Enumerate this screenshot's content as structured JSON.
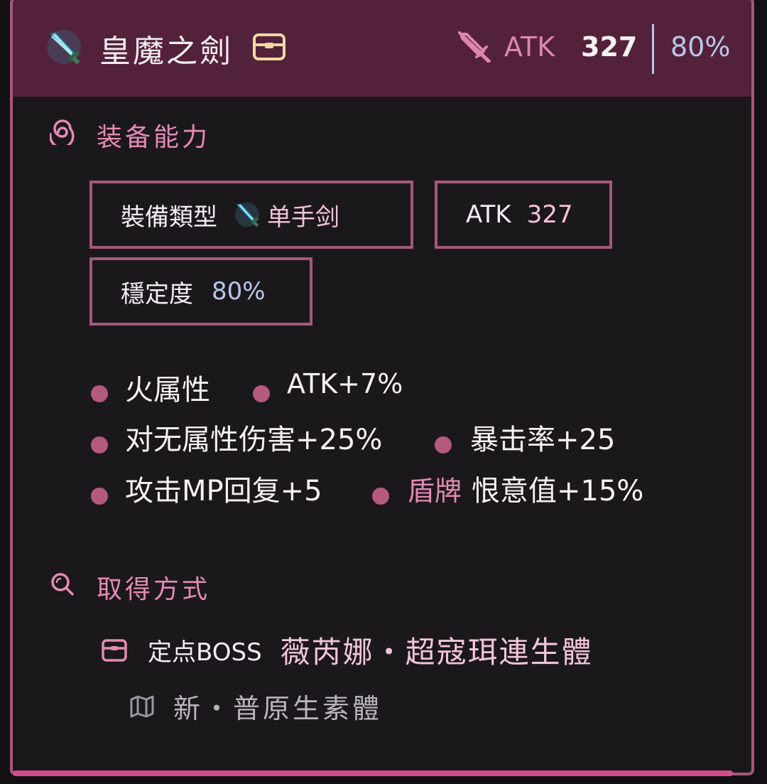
{
  "header": {
    "item_name": "皇魔之劍",
    "atk_label": "ATK",
    "atk_value": "327",
    "stability": "80%",
    "icons": [
      "sword-item-icon",
      "chest-icon",
      "sword-off-icon"
    ]
  },
  "equip_section": {
    "title": "装备能力",
    "icon": "spiral-icon",
    "type_label": "裝備類型",
    "type_value": "单手剑",
    "atk_label": "ATK",
    "atk_value": "327",
    "stability_label": "穩定度",
    "stability_value": "80%"
  },
  "bonuses": [
    "火属性",
    "ATK+7%",
    "对无属性伤害+25%",
    "暴击率+25",
    "攻击MP回复+5",
    "恨意值+15%"
  ],
  "bonus_shield_tag": "盾牌",
  "source_section": {
    "title": "取得方式",
    "icon": "search-icon",
    "type": "定点BOSS",
    "boss_name": "薇芮娜・超寇珥連生體",
    "map_icon": "map-icon",
    "map_name": "新・普原生素體"
  },
  "colors": {
    "header_bg": "#54213a",
    "border": "#a4587e",
    "accent_pink": "#e48ab5",
    "accent_blue": "#b8c7ea",
    "bullet": "#b5597f"
  }
}
